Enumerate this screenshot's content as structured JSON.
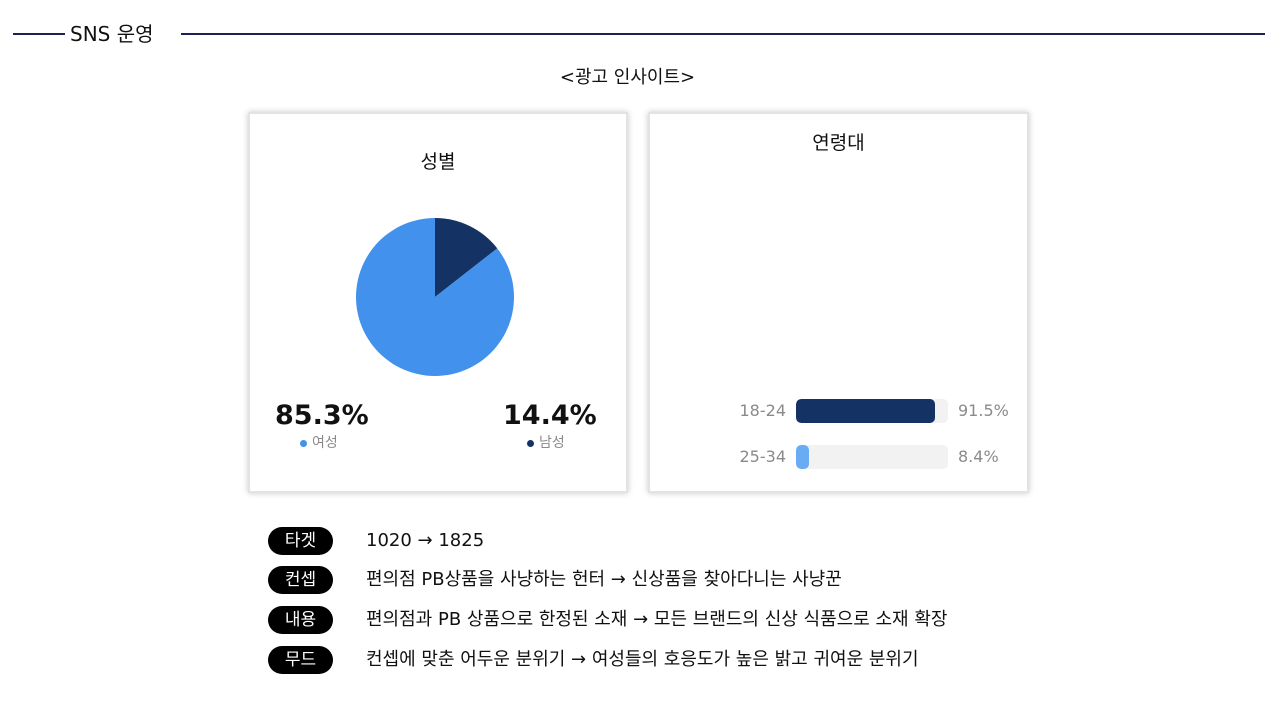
{
  "header": {
    "title": "SNS 운영"
  },
  "insight_title": "<광고 인사이트>",
  "colors": {
    "primary_navy": "#143263",
    "primary_blue": "#4291ec",
    "light_blue": "#6aacf3",
    "track": "#f2f2f2",
    "rule": "#1b2150"
  },
  "chart_data": [
    {
      "type": "pie",
      "title": "성별",
      "labels": [
        "여성",
        "남성"
      ],
      "values": [
        85.3,
        14.4
      ],
      "value_labels": [
        "85.3%",
        "14.4%"
      ],
      "colors": [
        "#4291ec",
        "#143263"
      ]
    },
    {
      "type": "bar",
      "orientation": "horizontal",
      "title": "연령대",
      "categories": [
        "18-24",
        "25-34"
      ],
      "values": [
        91.5,
        8.4
      ],
      "value_labels": [
        "91.5%",
        "8.4%"
      ],
      "colors": [
        "#143263",
        "#6aacf3"
      ],
      "xlim": [
        0,
        100
      ]
    }
  ],
  "info": [
    {
      "tag": "타겟",
      "text": "1020 → 1825"
    },
    {
      "tag": "컨셉",
      "text": "편의점 PB상품을 사냥하는 헌터 → 신상품을 찾아다니는 사냥꾼"
    },
    {
      "tag": "내용",
      "text": "편의점과 PB 상품으로 한정된 소재 → 모든 브랜드의 신상 식품으로 소재 확장"
    },
    {
      "tag": "무드",
      "text": "컨셉에 맞춘 어두운 분위기 → 여성들의 호응도가 높은 밝고 귀여운 분위기"
    }
  ]
}
